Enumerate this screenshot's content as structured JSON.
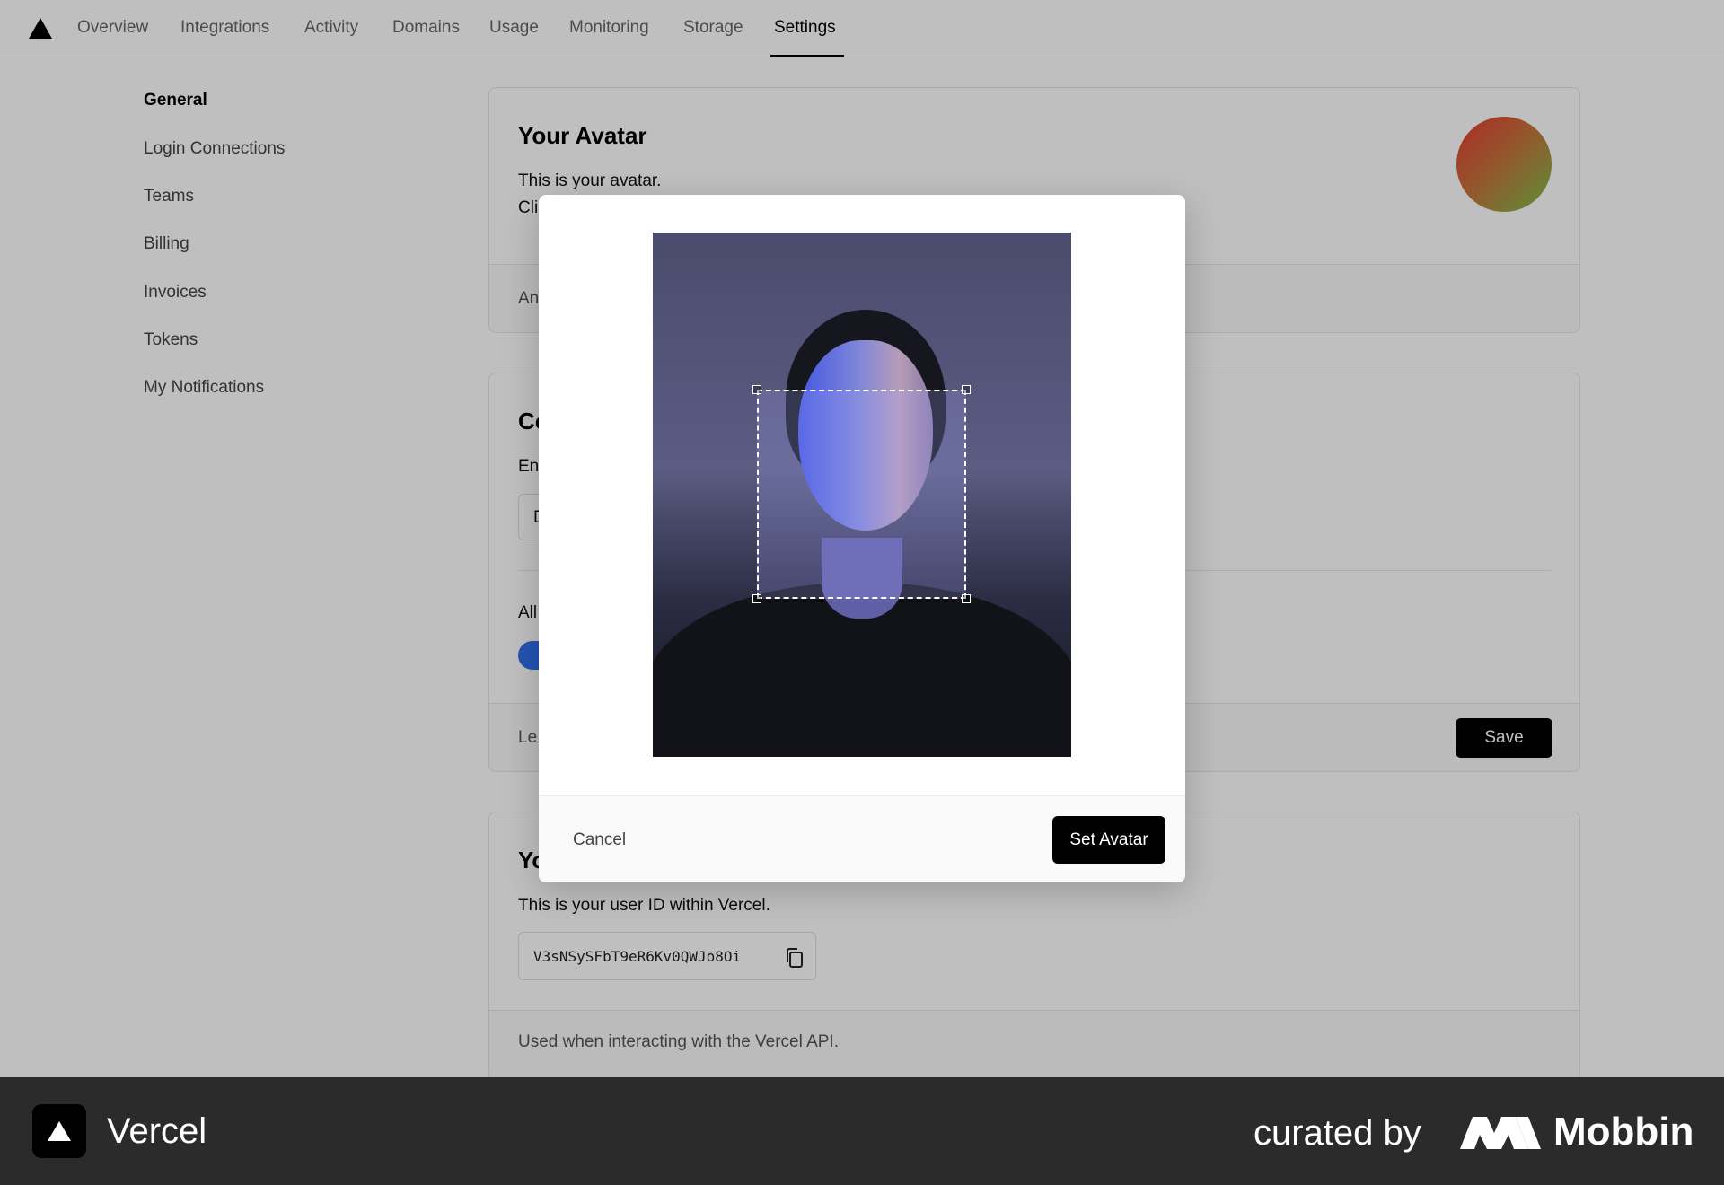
{
  "nav": {
    "tabs": [
      {
        "label": "Overview"
      },
      {
        "label": "Integrations"
      },
      {
        "label": "Activity"
      },
      {
        "label": "Domains"
      },
      {
        "label": "Usage"
      },
      {
        "label": "Monitoring"
      },
      {
        "label": "Storage"
      },
      {
        "label": "Settings",
        "active": true
      }
    ]
  },
  "sidebar": {
    "items": [
      {
        "label": "General",
        "active": true
      },
      {
        "label": "Login Connections"
      },
      {
        "label": "Teams"
      },
      {
        "label": "Billing"
      },
      {
        "label": "Invoices"
      },
      {
        "label": "Tokens"
      },
      {
        "label": "My Notifications"
      }
    ]
  },
  "avatar_card": {
    "title": "Your Avatar",
    "line1": "This is your avatar.",
    "line2_partial": "Cli",
    "footer_partial": "An",
    "avatar_gradient": [
      "#e53935",
      "#7cc04a"
    ]
  },
  "email_card": {
    "title_partial": "Co",
    "label_partial": "En",
    "input_partial": "D",
    "allow_partial": "All",
    "footer_partial": "Le",
    "save_label": "Save",
    "toggle_color": "#2f6fed"
  },
  "userid_card": {
    "title_partial": "Yo",
    "description": "This is your user ID within Vercel.",
    "user_id": "V3sNSySFbT9eR6Kv0QWJo8Oi",
    "footer": "Used when interacting with the Vercel API."
  },
  "modal": {
    "cancel_label": "Cancel",
    "confirm_label": "Set Avatar"
  },
  "banner": {
    "brand": "Vercel",
    "curated_by": "curated by",
    "mobbin": "Mobbin"
  }
}
